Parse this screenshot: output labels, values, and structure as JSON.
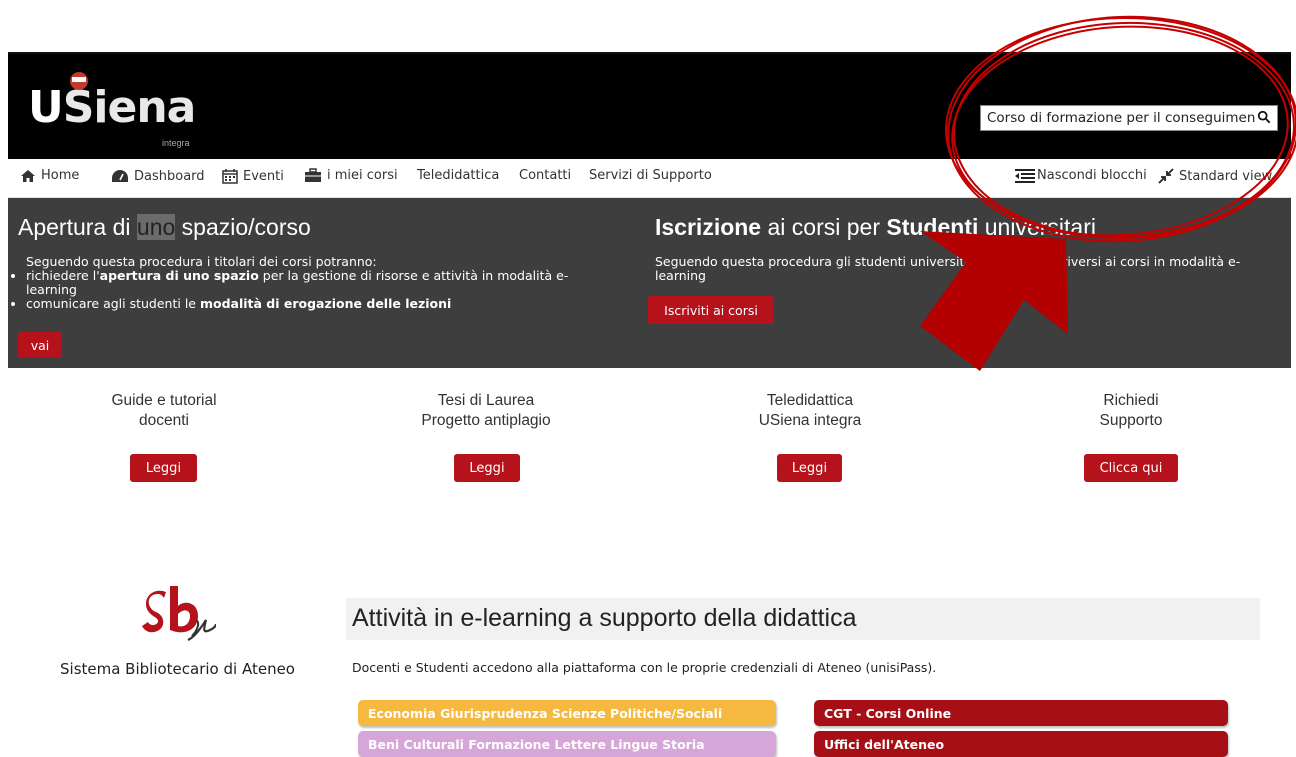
{
  "brand": {
    "logo_main": "USiena",
    "logo_u": "U",
    "logo_rest": "Siena",
    "logo_sub": "integra"
  },
  "search": {
    "value": "Corso di formazione per il conseguimento",
    "icon": "search-icon"
  },
  "nav": {
    "home": "Home",
    "dashboard": "Dashboard",
    "eventi": "Eventi",
    "miei_corsi": "i miei corsi",
    "teledidattica": "Teledidattica",
    "contatti": "Contatti",
    "servizi": "Servizi di Supporto",
    "nascondi": "Nascondi blocchi",
    "standard_view": "Standard view"
  },
  "hero": {
    "left": {
      "title_pre": "Apertura di ",
      "title_hl": "uno",
      "title_post": " spazio/corso",
      "intro": "Seguendo questa procedura i titolari dei corsi potranno:",
      "b1_pre": "richiedere l'",
      "b1_bold": "apertura di uno spazio",
      "b1_post": " per la gestione di risorse e attività in modalità e-learning",
      "b2_pre": "comunicare agli studenti le ",
      "b2_bold": "modalità di erogazione delle lezioni",
      "button": "vai"
    },
    "right": {
      "title_b1": "Iscrizione",
      "title_m": " ai corsi per ",
      "title_b2": "Studenti",
      "title_end": " universitari",
      "text": "Seguendo questa procedura gli studenti universitari potranno iscriversi ai corsi in modalità e-learning",
      "button": "Iscriviti ai corsi"
    }
  },
  "cards": [
    {
      "line1": "Guide e tutorial",
      "line2": "docenti",
      "button": "Leggi"
    },
    {
      "line1": "Tesi di Laurea",
      "line2": "Progetto antiplagio",
      "button": "Leggi"
    },
    {
      "line1": "Teledidattica",
      "line2": "USiena integra",
      "button": "Leggi"
    },
    {
      "line1": "Richiedi",
      "line2": "Supporto",
      "button": "Clicca qui"
    }
  ],
  "sba": {
    "caption": "Sistema Bibliotecario di Ateneo"
  },
  "elearning": {
    "title": "Attività in e-learning a supporto della didattica",
    "intro": "Docenti e Studenti accedono alla piattaforma con le proprie credenziali di Ateneo (unisiPass).",
    "pills": [
      {
        "label": "Economia Giurisprudenza Scienze Politiche/Sociali",
        "color": "#f5b942"
      },
      {
        "label": "Beni Culturali Formazione Lettere Lingue Storia",
        "color": "#d7a6d9"
      },
      {
        "label": "CGT - Corsi Online",
        "color": "#a50f15"
      },
      {
        "label": "Uffici dell'Ateneo",
        "color": "#a50f15"
      }
    ]
  },
  "annotation": {
    "ellipse_color": "#c40000",
    "arrow_color": "#b30000"
  }
}
